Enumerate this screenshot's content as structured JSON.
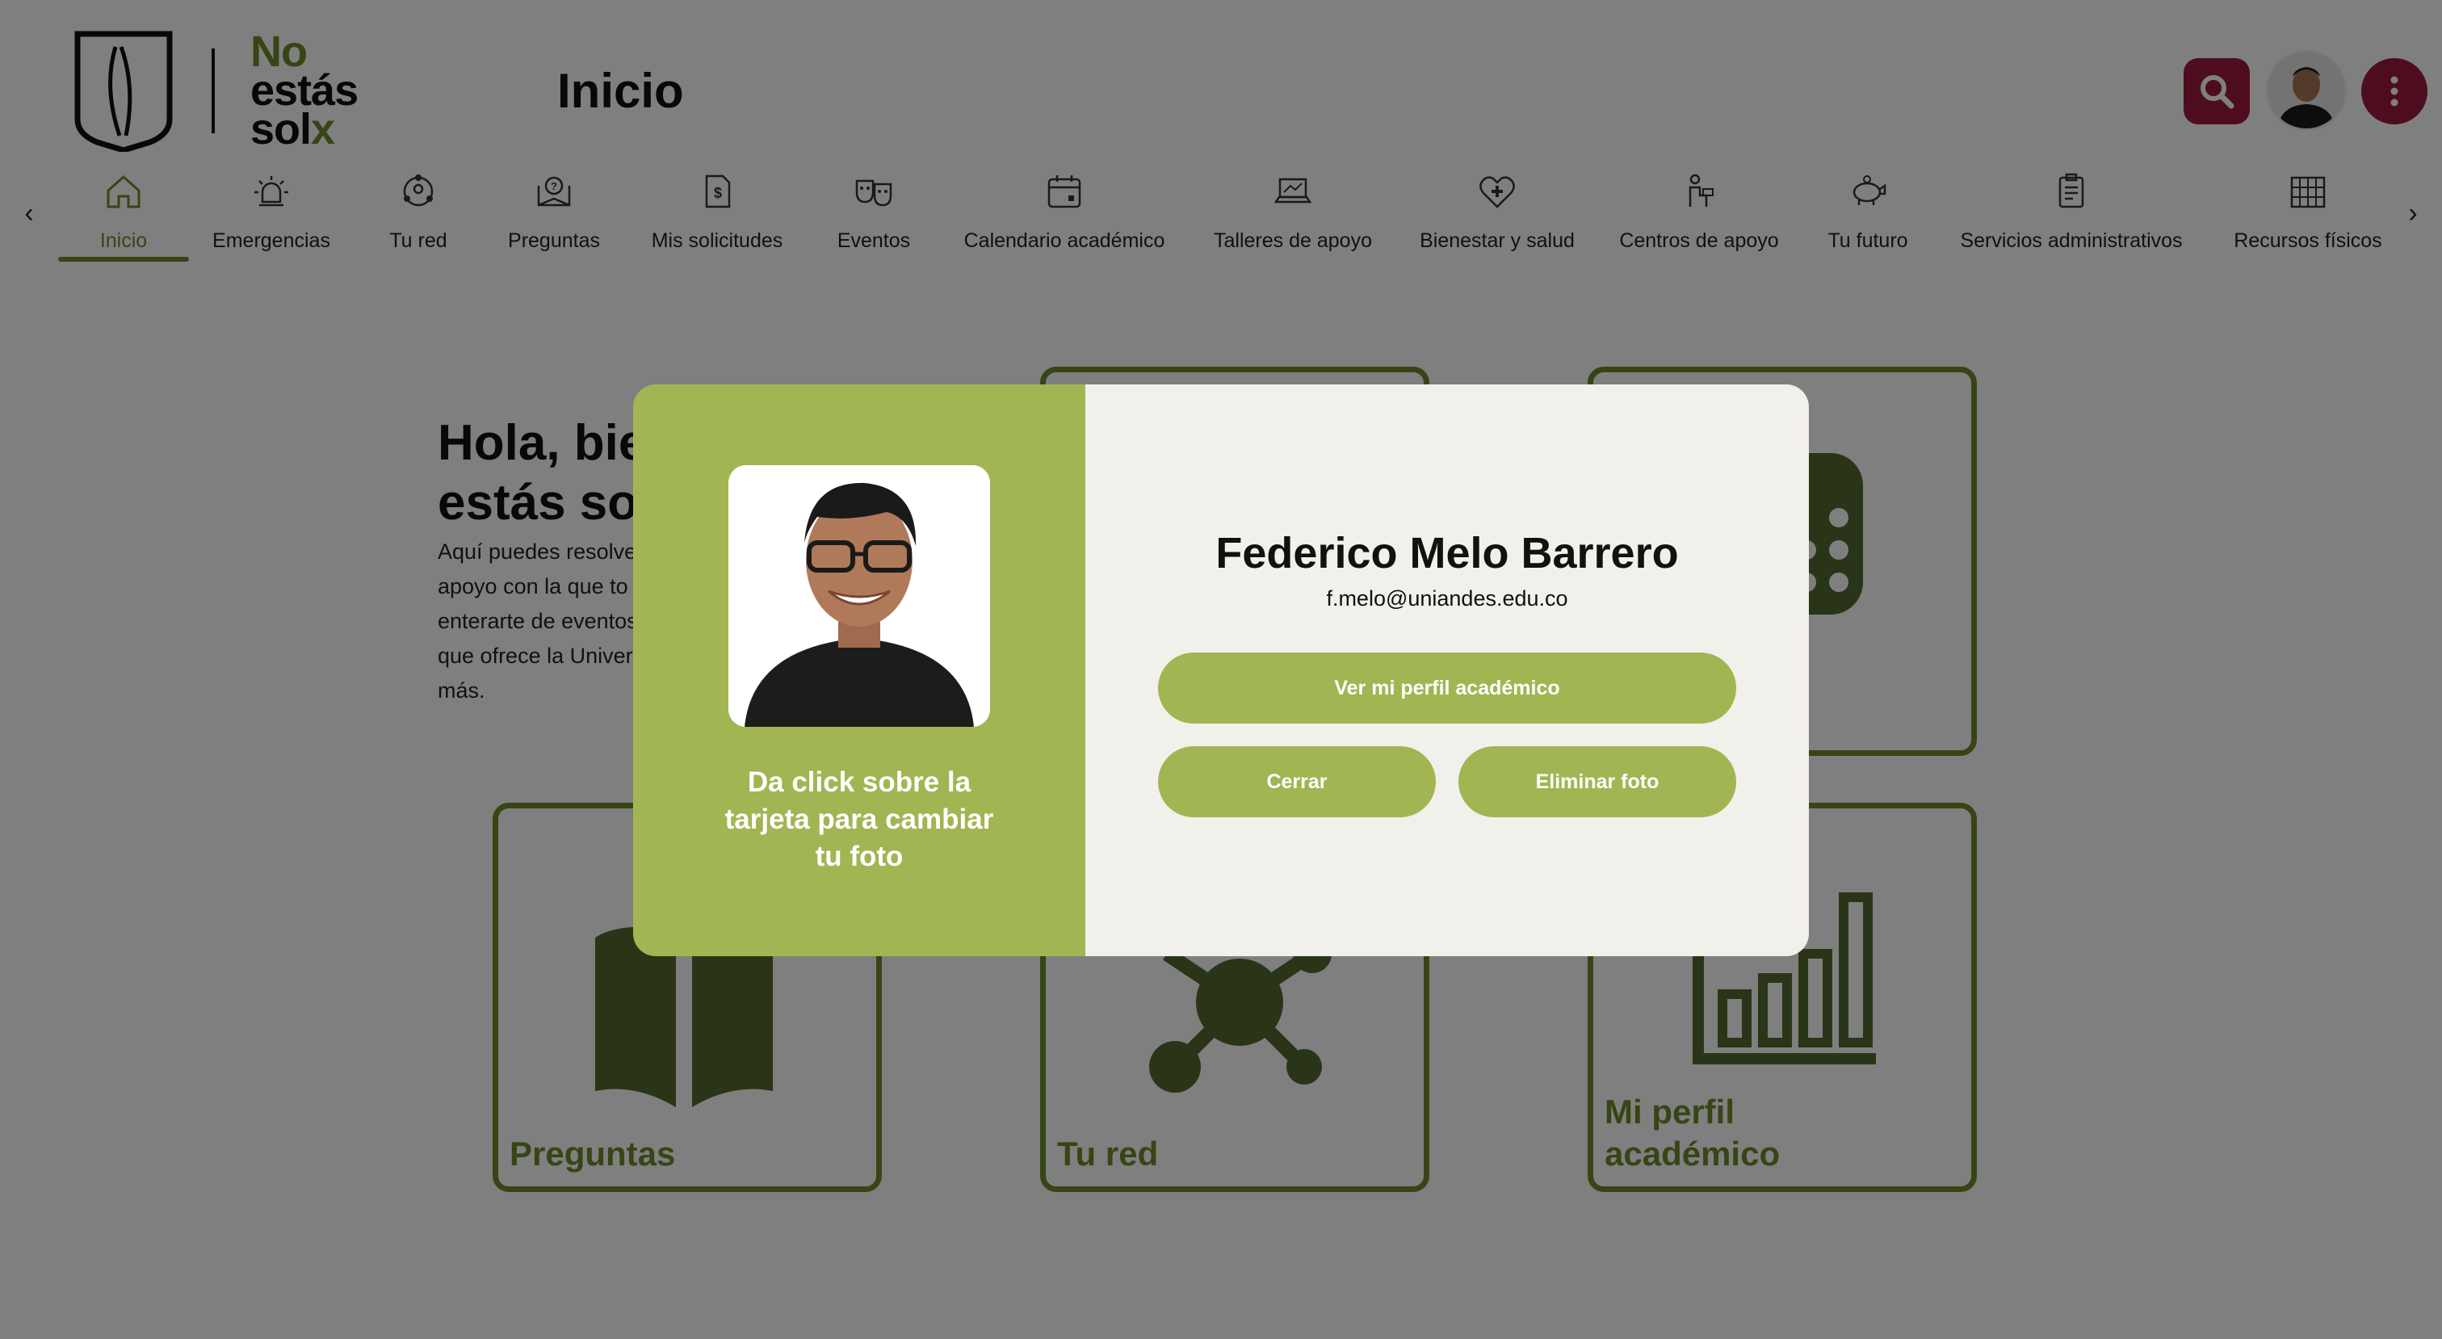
{
  "header": {
    "logo": {
      "line1": "No",
      "line2": "estás",
      "line3a": "sol",
      "line3b": "x"
    },
    "page_title": "Inicio"
  },
  "nav": {
    "items": [
      {
        "label": "Inicio",
        "icon": "home-icon",
        "active": true
      },
      {
        "label": "Emergencias",
        "icon": "alarm-icon"
      },
      {
        "label": "Tu red",
        "icon": "network-icon"
      },
      {
        "label": "Preguntas",
        "icon": "questions-book-icon"
      },
      {
        "label": "Mis solicitudes",
        "icon": "request-document-icon"
      },
      {
        "label": "Eventos",
        "icon": "theater-masks-icon"
      },
      {
        "label": "Calendario académico",
        "icon": "calendar-icon"
      },
      {
        "label": "Talleres de apoyo",
        "icon": "laptop-workshop-icon"
      },
      {
        "label": "Bienestar y salud",
        "icon": "heart-plus-icon"
      },
      {
        "label": "Centros de apoyo",
        "icon": "support-center-icon"
      },
      {
        "label": "Tu futuro",
        "icon": "piggy-bank-icon"
      },
      {
        "label": "Servicios administrativos",
        "icon": "clipboard-icon"
      },
      {
        "label": "Recursos físicos",
        "icon": "building-icon"
      }
    ]
  },
  "main": {
    "greeting_line1": "Hola, bie",
    "greeting_line2": "estás sol",
    "intro_lines": [
      "Aquí puedes resolve",
      "apoyo con la que to",
      "enterarte de eventos",
      "que ofrece la Univers",
      "más."
    ],
    "cards": {
      "preguntas": "Preguntas",
      "tu_red": "Tu red",
      "perfil_line1": "Mi perfil",
      "perfil_line2": "académico"
    }
  },
  "modal": {
    "hint": "Da click sobre la tarjeta para cambiar tu foto",
    "name": "Federico Melo Barrero",
    "email": "f.melo@uniandes.edu.co",
    "profile_button": "Ver mi perfil académico",
    "close_button": "Cerrar",
    "delete_button": "Eliminar foto"
  },
  "colors": {
    "brand_green": "#6f8a2b",
    "modal_green": "#a2b553",
    "accent_red": "#9c1a3c",
    "modal_bg": "#f2f0ea"
  }
}
